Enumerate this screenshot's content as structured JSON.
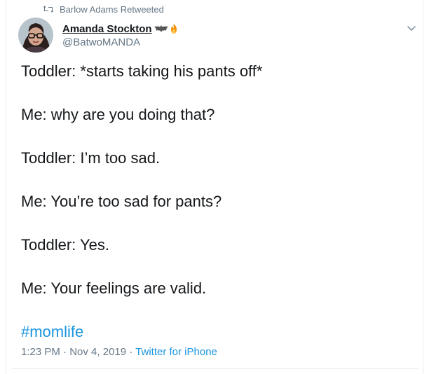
{
  "retweet": {
    "label": "Barlow Adams Retweeted",
    "icon": "retweet-icon"
  },
  "author": {
    "display_name": "Amanda Stockton",
    "handle": "@BatwoMANDA",
    "name_emojis": [
      "bat-icon",
      "fire-icon"
    ],
    "avatar_icon": "avatar"
  },
  "menu": {
    "icon": "chevron-down-icon"
  },
  "tweet": {
    "lines": [
      "Toddler: *starts taking his pants off*",
      "",
      "Me: why are you doing that?",
      "",
      "Toddler: I’m too sad.",
      "",
      "Me: You’re too sad for pants?",
      "",
      "Toddler: Yes.",
      "",
      "Me: Your feelings are valid.",
      "",
      "#momlife"
    ],
    "hashtag": "#momlife"
  },
  "meta": {
    "time": "1:23 PM",
    "separator": " · ",
    "date": "Nov 4, 2019",
    "source": "Twitter for iPhone"
  },
  "colors": {
    "text": "#14171a",
    "secondary": "#657786",
    "link": "#1b95e0",
    "border": "#e6ecf0"
  }
}
